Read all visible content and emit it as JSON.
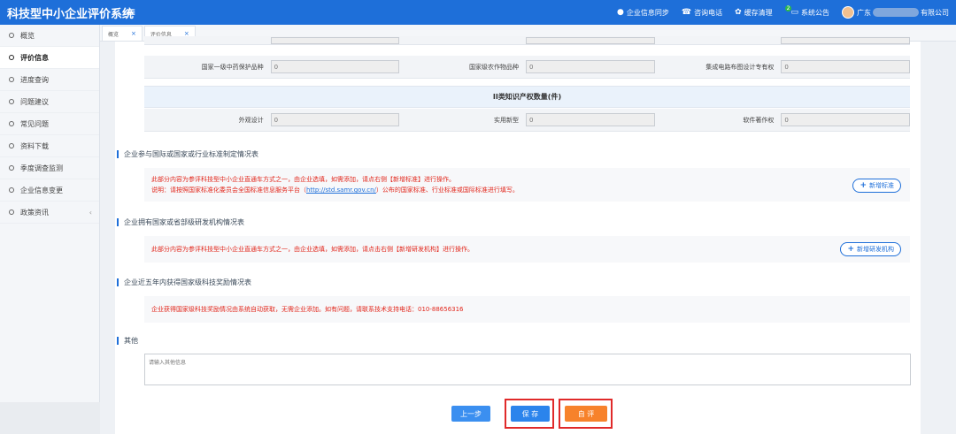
{
  "header": {
    "app_title": "科技型中小企业评价系统",
    "menu_icon": "hamburger-icon",
    "items": [
      {
        "icon": "user-icon",
        "label": "企业信息同步"
      },
      {
        "icon": "phone-icon",
        "label": "咨询电话"
      },
      {
        "icon": "refresh-icon",
        "label": "缓存清理"
      },
      {
        "icon": "notice-icon",
        "label": "系统公告",
        "badge": "2"
      }
    ],
    "company_prefix": "广东",
    "company_suffix": "有限公司"
  },
  "sidebar": {
    "items": [
      {
        "label": "概览"
      },
      {
        "label": "评价信息",
        "active": true
      },
      {
        "label": "进度查询"
      },
      {
        "label": "问题建议"
      },
      {
        "label": "常见问题"
      },
      {
        "label": "资料下载"
      },
      {
        "label": "季度调查监测"
      },
      {
        "label": "企业信息变更"
      },
      {
        "label": "政策资讯",
        "chevron": "‹"
      }
    ]
  },
  "tabs": [
    {
      "label": "概览"
    },
    {
      "label": "评价信息"
    }
  ],
  "ip_class1_row": {
    "fields": [
      {
        "label": "国家一级中药保护品种",
        "value": "0"
      },
      {
        "label": "国家级农作物品种",
        "value": "0"
      },
      {
        "label": "集成电路布图设计专有权",
        "value": "0"
      }
    ]
  },
  "ip_class2": {
    "heading": "II类知识产权数量(件)",
    "fields": [
      {
        "label": "外观设计",
        "value": "0"
      },
      {
        "label": "实用新型",
        "value": "0"
      },
      {
        "label": "软件著作权",
        "value": "0"
      }
    ]
  },
  "standards": {
    "title": "企业参与国际或国家或行业标准制定情况表",
    "line1": "此部分内容为参评科技型中小企业直通车方式之一，由企业选填，如需添加，请点右侧【新增标准】进行操作。",
    "line2_prefix": "说明：请按照国家标准化委员会全国标准信息服务平台（",
    "line2_link": "http://std.samr.gov.cn/",
    "line2_suffix": "）公布的国家标准、行业标准或国际标准进行填写。",
    "button": "新增标准"
  },
  "rnd": {
    "title": "企业拥有国家或省部级研发机构情况表",
    "line1": "此部分内容为参评科技型中小企业直通车方式之一，由企业选填，如需添加，请点击右侧【新增研发机构】进行操作。",
    "button": "新增研发机构"
  },
  "awards": {
    "title": "企业近五年内获得国家级科技奖励情况表",
    "line1": "企业获得国家级科技奖励情况由系统自动获取，无需企业添加。如有问题，请联系技术支持电话：010-88656316"
  },
  "other": {
    "title": "其他",
    "placeholder": "请输入其他信息"
  },
  "actions": {
    "prev": "上一步",
    "save": "保 存",
    "review": "自 评"
  },
  "colors": {
    "header": "#1e6fd9",
    "notice_red": "#e2271c",
    "save": "#2b84ec",
    "review": "#f7822b",
    "highlight": "#e02a2a"
  }
}
